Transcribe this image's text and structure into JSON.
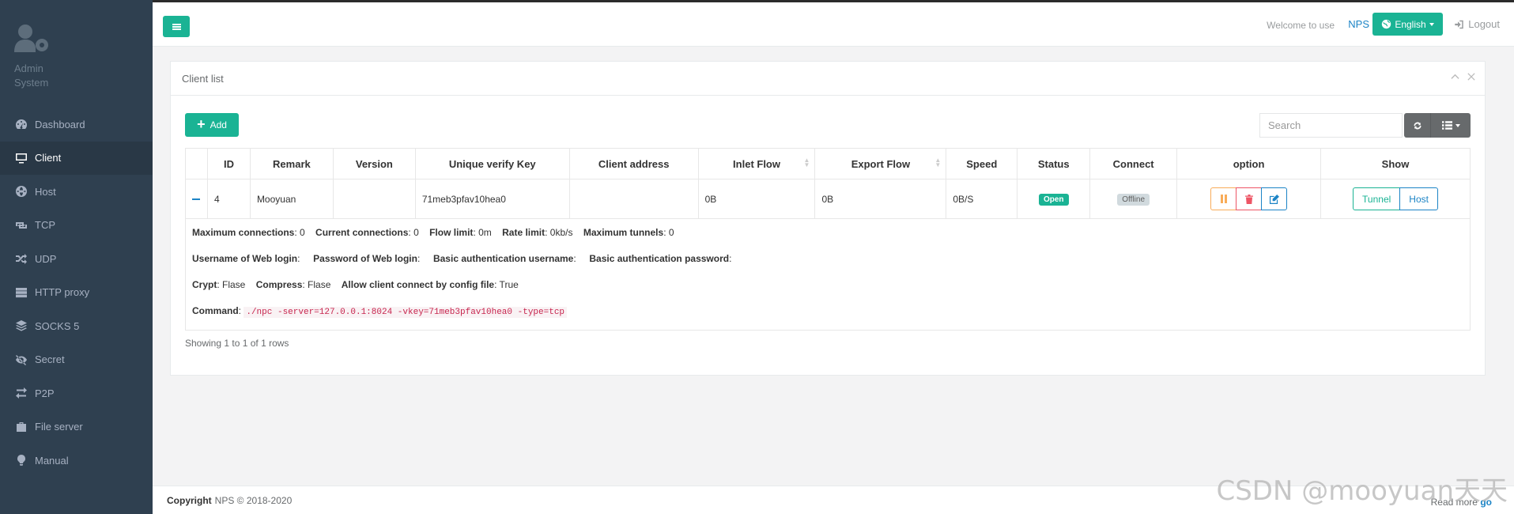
{
  "sidebar": {
    "profile": {
      "name_line1": "Admin",
      "name_line2": "System"
    },
    "items": [
      {
        "label": "Dashboard",
        "icon": "dashboard-icon"
      },
      {
        "label": "Client",
        "icon": "desktop-icon",
        "active": true
      },
      {
        "label": "Host",
        "icon": "globe-icon"
      },
      {
        "label": "TCP",
        "icon": "retweet-icon"
      },
      {
        "label": "UDP",
        "icon": "random-icon"
      },
      {
        "label": "HTTP proxy",
        "icon": "server-icon"
      },
      {
        "label": "SOCKS 5",
        "icon": "layers-icon"
      },
      {
        "label": "Secret",
        "icon": "eye-slash-icon"
      },
      {
        "label": "P2P",
        "icon": "exchange-icon"
      },
      {
        "label": "File server",
        "icon": "briefcase-icon"
      },
      {
        "label": "Manual",
        "icon": "lightbulb-icon"
      }
    ]
  },
  "topbar": {
    "welcome": "Welcome to use",
    "brand": "NPS",
    "language": "English",
    "logout": "Logout"
  },
  "panel": {
    "title": "Client list",
    "add_label": "Add",
    "search_placeholder": "Search",
    "columns": [
      "ID",
      "Remark",
      "Version",
      "Unique verify Key",
      "Client address",
      "Inlet Flow",
      "Export Flow",
      "Speed",
      "Status",
      "Connect",
      "option",
      "Show"
    ],
    "row": {
      "id": "4",
      "remark": "Mooyuan",
      "version": "",
      "verify_key": "71meb3pfav10hea0",
      "client_address": "",
      "inlet_flow": "0B",
      "export_flow": "0B",
      "speed": "0B/S",
      "status": "Open",
      "connect": "Offline"
    },
    "detail": {
      "max_conn_label": "Maximum connections",
      "max_conn_value": ": 0",
      "cur_conn_label": "Current connections",
      "cur_conn_value": ": 0",
      "flow_limit_label": "Flow limit",
      "flow_limit_value": ": 0m",
      "rate_limit_label": "Rate limit",
      "rate_limit_value": ": 0kb/s",
      "max_tunnels_label": "Maximum tunnels",
      "max_tunnels_value": ": 0",
      "web_user_label": "Username of Web login",
      "web_user_value": ":",
      "web_pass_label": "Password of Web login",
      "web_pass_value": ":",
      "basic_user_label": "Basic authentication username",
      "basic_user_value": ":",
      "basic_pass_label": "Basic authentication password",
      "basic_pass_value": ":",
      "crypt_label": "Crypt",
      "crypt_value": ": Flase",
      "compress_label": "Compress",
      "compress_value": ": Flase",
      "allow_config_label": "Allow client connect by config file",
      "allow_config_value": ": True",
      "command_label": "Command",
      "command_sep": ":",
      "command_value": "./npc -server=127.0.0.1:8024 -vkey=71meb3pfav10hea0 -type=tcp"
    },
    "show_tunnel": "Tunnel",
    "show_host": "Host",
    "showing": "Showing 1 to 1 of 1 rows"
  },
  "footer": {
    "copyright_label": "Copyright",
    "copyright_text": "NPS © 2018-2020",
    "read_more": "Read more",
    "go": "go"
  },
  "watermark": "CSDN @mooyuan天天",
  "colors": {
    "accent": "#1ab394",
    "sidebar": "#2f4050",
    "link": "#1c84c6",
    "danger": "#ed5565",
    "warning": "#f8ac59"
  }
}
